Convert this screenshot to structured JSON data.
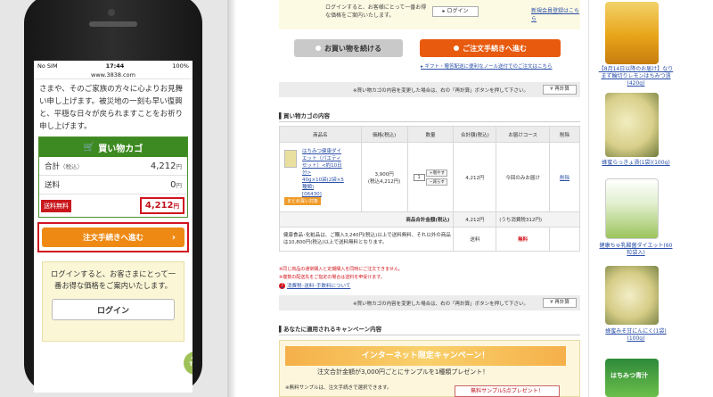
{
  "phone": {
    "status": {
      "carrier": "No SIM",
      "time": "17:44",
      "battery": "100%"
    },
    "url": "www.3838.com",
    "intro_text": "さまや、そのご家族の方々に心よりお見舞い申し上げます。被災地の一刻も早い復興と、平穏な日々が戻られますことをお祈り申し上げます。",
    "cart": {
      "title": "買い物カゴ",
      "subtotal_label": "合計",
      "subtotal_tax": "（税込）",
      "subtotal_value": "4,212",
      "shipping_label": "送料",
      "shipping_value": "0",
      "yen": "円",
      "free_badge": "送料無料",
      "total_value": "4,212"
    },
    "checkout_label": "注文手続きへ進む",
    "login_note": "ログインすると、お客さまにとって一番お得な価格をご案内いたします。",
    "login_label": "ログイン",
    "top_label": "TOP"
  },
  "desktop": {
    "notice_text": "ログインすると、お客様にとって一番お得な価格をご案内いたします。",
    "notice_login": "ログイン",
    "notice_register": "新規会員登録はこちら",
    "continue_label": "お買い物を続ける",
    "proceed_label": "ご注文手続きへ進む",
    "gift_link": "ギフト・贈答配送に便利なノール送付でのご注文はこちら",
    "recalc_text": "※買い物カゴの内容を変更した場合は、右の「再計算」ボタンを押して下さい。",
    "recalc_label": "再計算",
    "section_title": "買い物カゴの内容",
    "table": {
      "headers": [
        "商品名",
        "価格(税込)",
        "数量",
        "合計額(税込)",
        "お届けコース",
        "削除"
      ],
      "product_name": "はちみつ健康ダイエット（パエティセット）<約10日分>",
      "product_sub": "40g×10袋(2袋×5種類)",
      "product_code": "[06430]",
      "product_tag": "まとめ買い対象",
      "price": "3,900円",
      "price_tax": "(税込4,212円)",
      "qty": "1",
      "qty_up": "増やす",
      "qty_down": "減らす",
      "line_total": "4,212円",
      "course": "今回のみお届け",
      "delete": "削除",
      "sum_label": "商品合計金額(税込)",
      "sum_value": "4,212円",
      "sum_tax": "(うち消費税312円)",
      "ship_note": "健康食品･化粧品は、ご購入3,240円(税込)以上で送料無料、それ以外の商品は10,800円(税込)以上で送料無料となります。",
      "ship_label": "送料",
      "ship_value": "無料"
    },
    "foot_note_1": "※同じ商品の通常購入と定期購入を同時にご注文できません。",
    "foot_note_2": "※複数の配送先をご指定の場合は送料を申受けます。",
    "foot_link": "消費税･送料･手数料について",
    "campaign_title": "あなたに適用されるキャンペーン内容",
    "campaign_banner": "インターネット限定キャンペーン！",
    "campaign_sub": "注文合計金額が3,000円ごとにサンプルを1種類プレゼント！",
    "campaign_note": "※無料サンプルは、注文手続きで選択できます。",
    "campaign_gift": "無料サンプル5点プレゼント！"
  },
  "products": [
    {
      "caption": "【8月14日以降のお届け】なりまず輪切りレモンはちみつ漬(420g)"
    },
    {
      "caption": "蜂蜜らっきょ漬(1袋)(100g)"
    },
    {
      "caption": "健康ちゅ乳酸菌ダイエット(60粒袋入)"
    },
    {
      "caption": "蜂蜜みそ甘にんにく(1袋)(100g)"
    },
    {
      "caption": "はちみつ青汁"
    }
  ],
  "colors": {
    "green": "#3e8a22",
    "orange": "#ee8a14",
    "red": "#d01420",
    "proceed": "#e85a0e"
  }
}
